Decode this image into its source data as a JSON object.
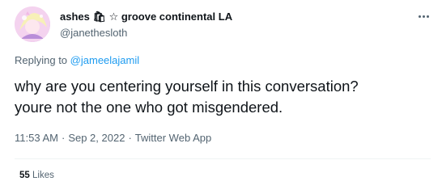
{
  "author": {
    "display_name": "ashes 🛍 ☆ groove continental LA",
    "handle": "@janethesloth",
    "avatar": "avatar-image"
  },
  "reply": {
    "prefix": "Replying to",
    "mention": "@jameelajamil"
  },
  "tweet": {
    "line1": "why are you centering yourself in this conversation?",
    "line2": "youre not the one who got misgendered."
  },
  "meta": {
    "time": "11:53 AM",
    "separator": "·",
    "date": "Sep 2, 2022",
    "source": "Twitter Web App"
  },
  "stats": {
    "likes_count": "55",
    "likes_label": "Likes"
  },
  "icons": {
    "more": "more-options-icon"
  },
  "colors": {
    "link": "#1d9bf0",
    "secondary_text": "#536471",
    "primary_text": "#0f1419"
  }
}
